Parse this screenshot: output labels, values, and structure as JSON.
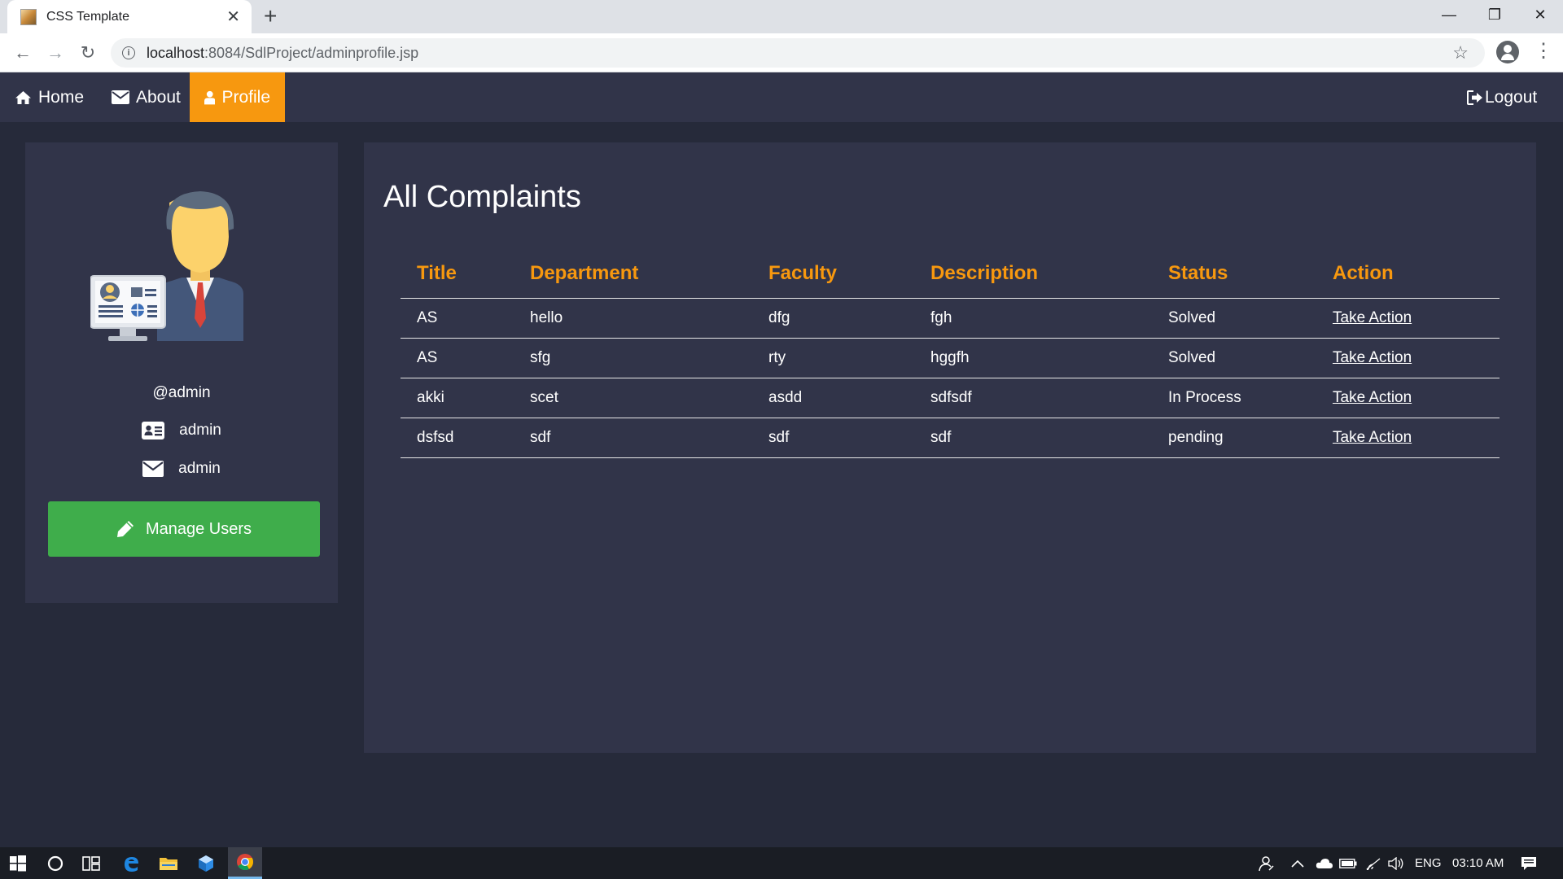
{
  "browser": {
    "tab_title": "CSS Template",
    "url_host": "localhost",
    "url_path": ":8084/SdlProject/adminprofile.jsp"
  },
  "nav": {
    "home": "Home",
    "about": "About",
    "profile": "Profile",
    "logout": "Logout",
    "active_color": "#f7980f"
  },
  "profile": {
    "username": "@admin",
    "name": "admin",
    "email": "admin",
    "manage_users": "Manage Users",
    "button_color": "#3fad4b"
  },
  "complaints": {
    "title": "All Complaints",
    "columns": [
      "Title",
      "Department",
      "Faculty",
      "Description",
      "Status",
      "Action"
    ],
    "rows": [
      {
        "title": "AS",
        "department": "hello",
        "faculty": "dfg",
        "description": "fgh",
        "status": "Solved",
        "action": "Take Action"
      },
      {
        "title": "AS",
        "department": "sfg",
        "faculty": "rty",
        "description": "hggfh",
        "status": "Solved",
        "action": "Take Action"
      },
      {
        "title": "akki",
        "department": "scet",
        "faculty": "asdd",
        "description": "sdfsdf",
        "status": "In Process",
        "action": "Take Action"
      },
      {
        "title": "dsfsd",
        "department": "sdf",
        "faculty": "sdf",
        "description": "sdf",
        "status": "pending",
        "action": "Take Action"
      }
    ]
  },
  "taskbar": {
    "language": "ENG",
    "time": "03:10 AM"
  }
}
